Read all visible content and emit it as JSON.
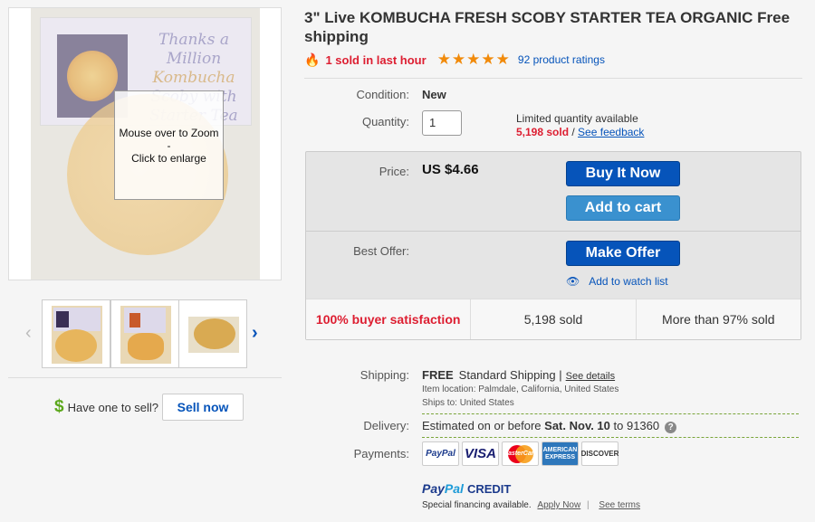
{
  "gallery": {
    "card_line1": "Thanks a Million",
    "card_line2": "Kombucha",
    "card_line3": "Scoby with",
    "card_line4": "Starter Tea",
    "zoom_line1": "Mouse over to Zoom",
    "zoom_line2": "-",
    "zoom_line3": "Click to enlarge",
    "prev_arrow": "‹",
    "next_arrow": "›"
  },
  "sell": {
    "dollar": "$",
    "question": "Have one to sell?",
    "button": "Sell now"
  },
  "listing": {
    "title": "3\" Live KOMBUCHA FRESH SCOBY STARTER TEA ORGANIC Free shipping",
    "sold_last_hour": "1 sold in last hour",
    "rating_stars": 5,
    "ratings_count": "92 product ratings",
    "condition_label": "Condition:",
    "condition_value": "New",
    "quantity_label": "Quantity:",
    "quantity_value": "1",
    "limited": "Limited quantity available",
    "sold_count": "5,198 sold",
    "see_feedback": "See feedback"
  },
  "buybox": {
    "price_label": "Price:",
    "price_value": "US $4.66",
    "buy_now": "Buy It Now",
    "add_to_cart": "Add to cart",
    "best_offer_label": "Best Offer:",
    "make_offer": "Make Offer",
    "watch": "Add to watch list",
    "stats": [
      "100% buyer satisfaction",
      "5,198 sold",
      "More than 97% sold"
    ]
  },
  "shipping": {
    "label": "Shipping:",
    "free": "FREE",
    "method": "Standard Shipping",
    "see_details": "See details",
    "location": "Item location:  Palmdale, California, United States",
    "ships_to": "Ships to:  United States",
    "delivery_label": "Delivery:",
    "delivery_prefix": "Estimated on or before",
    "delivery_date": "Sat. Nov. 10",
    "delivery_suffix": "to 91360"
  },
  "payments": {
    "label": "Payments:",
    "logos": [
      "PayPal",
      "VISA",
      "MasterCard",
      "AMERICAN EXPRESS",
      "DISCOVER"
    ],
    "credit_pay": "Pay",
    "credit_pal": "Pal",
    "credit_word": "CREDIT",
    "special": "Special financing available.",
    "apply_now": "Apply Now",
    "see_terms": "See terms"
  },
  "colors": {
    "link": "#0654ba",
    "alert_red": "#dd1e31",
    "star_orange": "#f18a0a",
    "buy_blue": "#0654ba",
    "cart_blue": "#3a91cf"
  }
}
